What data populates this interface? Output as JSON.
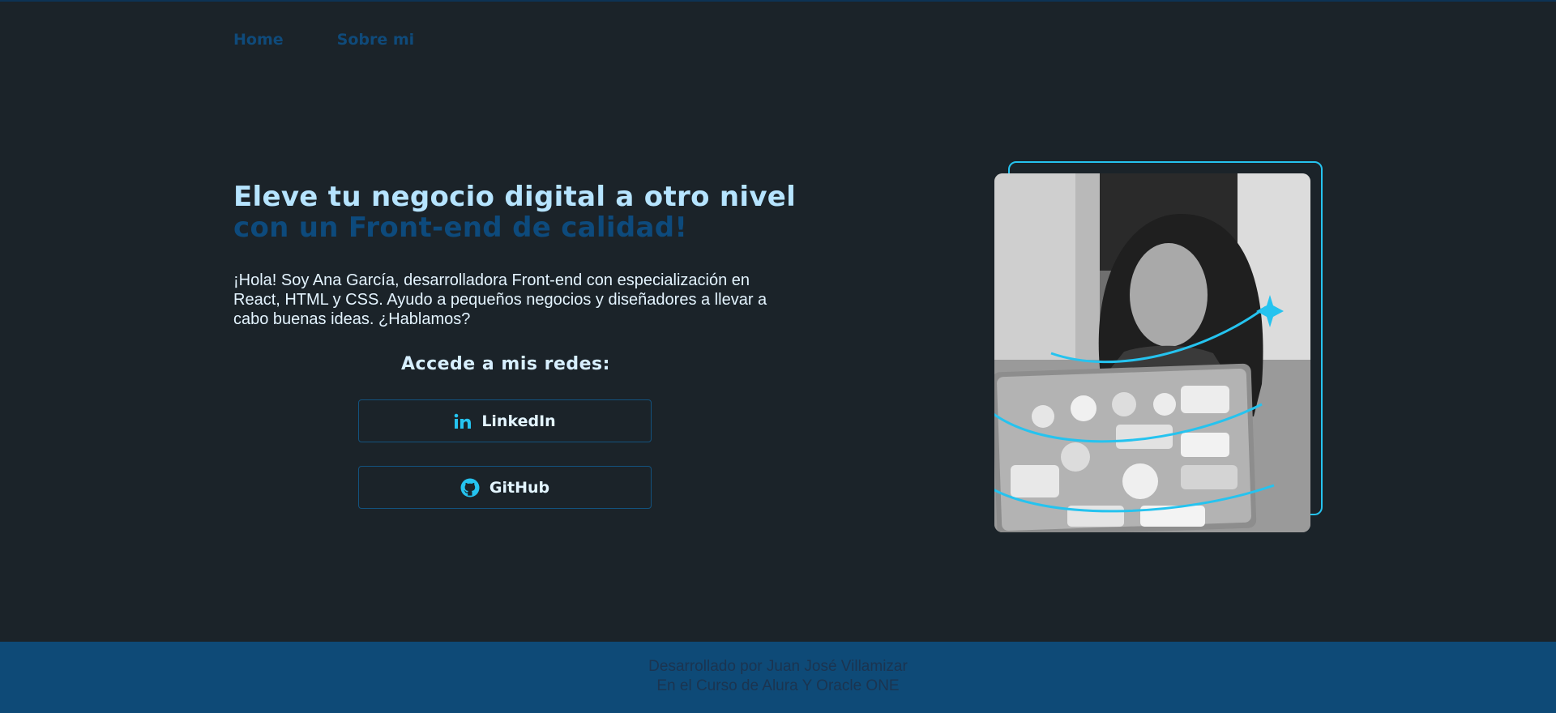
{
  "nav": {
    "items": [
      {
        "label": "Home"
      },
      {
        "label": "Sobre mi"
      }
    ]
  },
  "hero": {
    "title_main": "Eleve tu negocio digital a otro nivel",
    "title_accent": "con un Front-end de calidad!",
    "intro": "¡Hola! Soy Ana García, desarrolladora Front-end con especialización en React, HTML y CSS. Ayudo a pequeños negocios y diseñadores a llevar a cabo buenas ideas. ¿Hablamos?"
  },
  "social": {
    "heading": "Accede a mis redes:",
    "linkedin_label": "LinkedIn",
    "linkedin_icon": "linkedin-icon",
    "github_label": "GitHub",
    "github_icon": "github-icon"
  },
  "footer": {
    "line1": "Desarrollado por Juan José Villamizar",
    "line2": "En el Curso de Alura Y Oracle ONE"
  },
  "colors": {
    "background": "#1b2329",
    "accent_cyan": "#25c3ef",
    "accent_blue": "#0d4a7c",
    "footer_bg": "#0e4a77",
    "title": "#b6e4ff"
  }
}
